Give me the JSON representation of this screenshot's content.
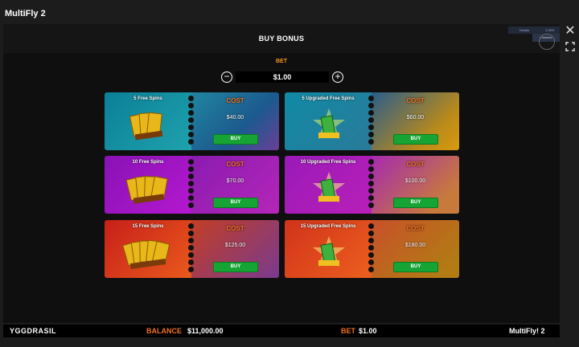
{
  "window": {
    "title": "MultiFly 2"
  },
  "modal": {
    "title": "BUY BONUS"
  },
  "mini_panel": {
    "a": "Details",
    "b": "1.05%",
    "tooltip": "Timeline"
  },
  "bet": {
    "label": "BET",
    "value": "$1.00",
    "minus": "−",
    "plus": "+"
  },
  "cards": [
    {
      "name": "5 Free Spins",
      "cost_label": "COST",
      "cost": "$40.00",
      "buy": "BUY"
    },
    {
      "name": "5 Upgraded Free Spins",
      "cost_label": "COST",
      "cost": "$60.00",
      "buy": "BUY"
    },
    {
      "name": "10 Free Spins",
      "cost_label": "COST",
      "cost": "$70.00",
      "buy": "BUY"
    },
    {
      "name": "10 Upgraded Free Spins",
      "cost_label": "COST",
      "cost": "$100.00",
      "buy": "BUY"
    },
    {
      "name": "15 Free Spins",
      "cost_label": "COST",
      "cost": "$125.00",
      "buy": "BUY"
    },
    {
      "name": "15 Upgraded Free Spins",
      "cost_label": "COST",
      "cost": "$180.00",
      "buy": "BUY"
    }
  ],
  "bottom": {
    "brand": "YGGDRASIL",
    "balance_label": "BALANCE",
    "balance": "$11,000.00",
    "bet_label": "BET",
    "bet": "$1.00",
    "game": "MultiFly! 2"
  },
  "icons": {
    "close": "close-icon",
    "expand": "fullscreen-icon"
  }
}
